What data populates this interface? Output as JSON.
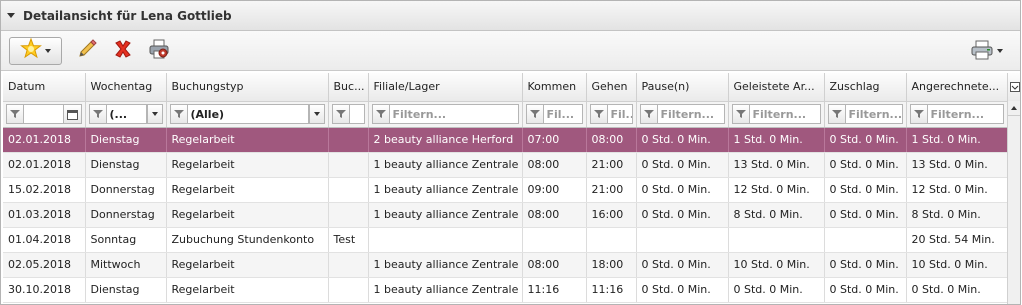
{
  "panel": {
    "title": "Detailansicht für Lena Gottlieb"
  },
  "toolbar": {
    "new_icon": "star-icon",
    "edit_icon": "pencil-icon",
    "delete_icon": "delete-x-icon",
    "print_preview_icon": "printer-preview-icon",
    "print_icon": "printer-icon"
  },
  "columns": [
    {
      "key": "datum",
      "label": "Datum"
    },
    {
      "key": "wochentag",
      "label": "Wochentag"
    },
    {
      "key": "buchungstyp",
      "label": "Buchungstyp"
    },
    {
      "key": "buc",
      "label": "Buc..."
    },
    {
      "key": "filiale",
      "label": "Filiale/Lager"
    },
    {
      "key": "kommen",
      "label": "Kommen"
    },
    {
      "key": "gehen",
      "label": "Gehen"
    },
    {
      "key": "pause",
      "label": "Pause(n)"
    },
    {
      "key": "geleistet",
      "label": "Geleistete Ar..."
    },
    {
      "key": "zuschlag",
      "label": "Zuschlag"
    },
    {
      "key": "angerechnet",
      "label": "Angerechnete..."
    }
  ],
  "filters": {
    "datum_value": "",
    "wochentag_value": "(...",
    "buchungstyp_value": "(Alle)",
    "filiale_placeholder": "Filtern...",
    "kommen_placeholder": "Fil...",
    "gehen_placeholder": "Fil...",
    "pause_placeholder": "Filtern...",
    "geleistet_placeholder": "Filtern...",
    "zuschlag_placeholder": "Filtern...",
    "angerechnet_placeholder": "Filtern..."
  },
  "rows": [
    {
      "datum": "02.01.2018",
      "wochentag": "Dienstag",
      "buchungstyp": "Regelarbeit",
      "buc": "",
      "filiale": "2 beauty alliance Herford",
      "kommen": "07:00",
      "gehen": "08:00",
      "pause": "0 Std. 0 Min.",
      "geleistet": "1 Std. 0 Min.",
      "zuschlag": "0 Std. 0 Min.",
      "angerechnet": "1 Std. 0 Min."
    },
    {
      "datum": "02.01.2018",
      "wochentag": "Dienstag",
      "buchungstyp": "Regelarbeit",
      "buc": "",
      "filiale": "1 beauty alliance Zentrale",
      "kommen": "08:00",
      "gehen": "21:00",
      "pause": "0 Std. 0 Min.",
      "geleistet": "13 Std. 0 Min.",
      "zuschlag": "0 Std. 0 Min.",
      "angerechnet": "13 Std. 0 Min."
    },
    {
      "datum": "15.02.2018",
      "wochentag": "Donnerstag",
      "buchungstyp": "Regelarbeit",
      "buc": "",
      "filiale": "1 beauty alliance Zentrale",
      "kommen": "09:00",
      "gehen": "21:00",
      "pause": "0 Std. 0 Min.",
      "geleistet": "12 Std. 0 Min.",
      "zuschlag": "0 Std. 0 Min.",
      "angerechnet": "12 Std. 0 Min."
    },
    {
      "datum": "01.03.2018",
      "wochentag": "Donnerstag",
      "buchungstyp": "Regelarbeit",
      "buc": "",
      "filiale": "1 beauty alliance Zentrale",
      "kommen": "08:00",
      "gehen": "16:00",
      "pause": "0 Std. 0 Min.",
      "geleistet": "8 Std. 0 Min.",
      "zuschlag": "0 Std. 0 Min.",
      "angerechnet": "8 Std. 0 Min."
    },
    {
      "datum": "01.04.2018",
      "wochentag": "Sonntag",
      "buchungstyp": "Zubuchung Stundenkonto",
      "buc": "Test",
      "filiale": "",
      "kommen": "",
      "gehen": "",
      "pause": "",
      "geleistet": "",
      "zuschlag": "",
      "angerechnet": "20 Std. 54 Min."
    },
    {
      "datum": "02.05.2018",
      "wochentag": "Mittwoch",
      "buchungstyp": "Regelarbeit",
      "buc": "",
      "filiale": "1 beauty alliance Zentrale",
      "kommen": "08:00",
      "gehen": "18:00",
      "pause": "0 Std. 0 Min.",
      "geleistet": "10 Std. 0 Min.",
      "zuschlag": "0 Std. 0 Min.",
      "angerechnet": "10 Std. 0 Min."
    },
    {
      "datum": "30.10.2018",
      "wochentag": "Dienstag",
      "buchungstyp": "Regelarbeit",
      "buc": "",
      "filiale": "1 beauty alliance Zentrale",
      "kommen": "11:16",
      "gehen": "11:16",
      "pause": "0 Std. 0 Min.",
      "geleistet": "0 Std. 0 Min.",
      "zuschlag": "0 Std. 0 Min.",
      "angerechnet": "0 Std. 0 Min."
    }
  ],
  "selected_row_index": 0,
  "colors": {
    "selection": "#a0587e",
    "row_alt": "#f5f5f5"
  }
}
